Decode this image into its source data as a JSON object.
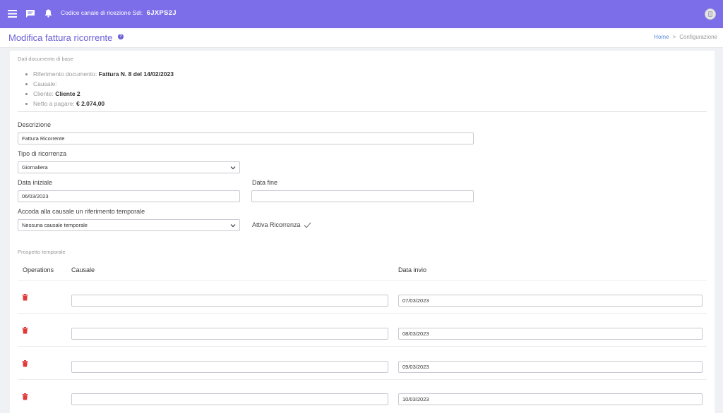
{
  "topbar": {
    "channel_label": "Codice canale di ricezione Sdi:",
    "channel_code": "6JXPS2J",
    "icons": [
      "menu-icon",
      "chat-icon",
      "bell-icon",
      "avatar-icon"
    ],
    "color": "#7b6ee8"
  },
  "header": {
    "title": "Modifica fattura ricorrente",
    "breadcrumb": {
      "home": "Home",
      "separator": ">",
      "current": "Configurazione"
    }
  },
  "basic_data": {
    "section_title": "Dati documento di base",
    "items": [
      {
        "label": "Riferimento documento:",
        "value": "Fattura N. 8 del 14/02/2023"
      },
      {
        "label": "Causale:",
        "value": ""
      },
      {
        "label": "Cliente:",
        "value": "Cliente 2"
      },
      {
        "label": "Netto a pagare:",
        "value": "€ 2.074,00"
      }
    ]
  },
  "form": {
    "descrizione_label": "Descrizione",
    "descrizione_value": "Fattura Ricorrente",
    "tipo_label": "Tipo di ricorrenza",
    "tipo_value": "Giornaliera",
    "data_iniziale_label": "Data iniziale",
    "data_iniziale_value": "06/03/2023",
    "data_fine_label": "Data fine",
    "data_fine_value": "",
    "accoda_label": "Accoda alla causale un riferimento temporale",
    "accoda_value": "Nessuna causale temporale",
    "attiva_label": "Attiva Ricorrenza"
  },
  "schedule": {
    "section_title": "Prospetto temporale",
    "columns": [
      "Operations",
      "Causale",
      "Data invio"
    ],
    "rows": [
      {
        "causale": "",
        "data_invio": "07/03/2023"
      },
      {
        "causale": "",
        "data_invio": "08/03/2023"
      },
      {
        "causale": "",
        "data_invio": "09/03/2023"
      },
      {
        "causale": "",
        "data_invio": "10/03/2023"
      }
    ]
  },
  "colors": {
    "accent": "#7b6ee8",
    "title": "#6a5fd6",
    "danger": "#e03a3a"
  }
}
